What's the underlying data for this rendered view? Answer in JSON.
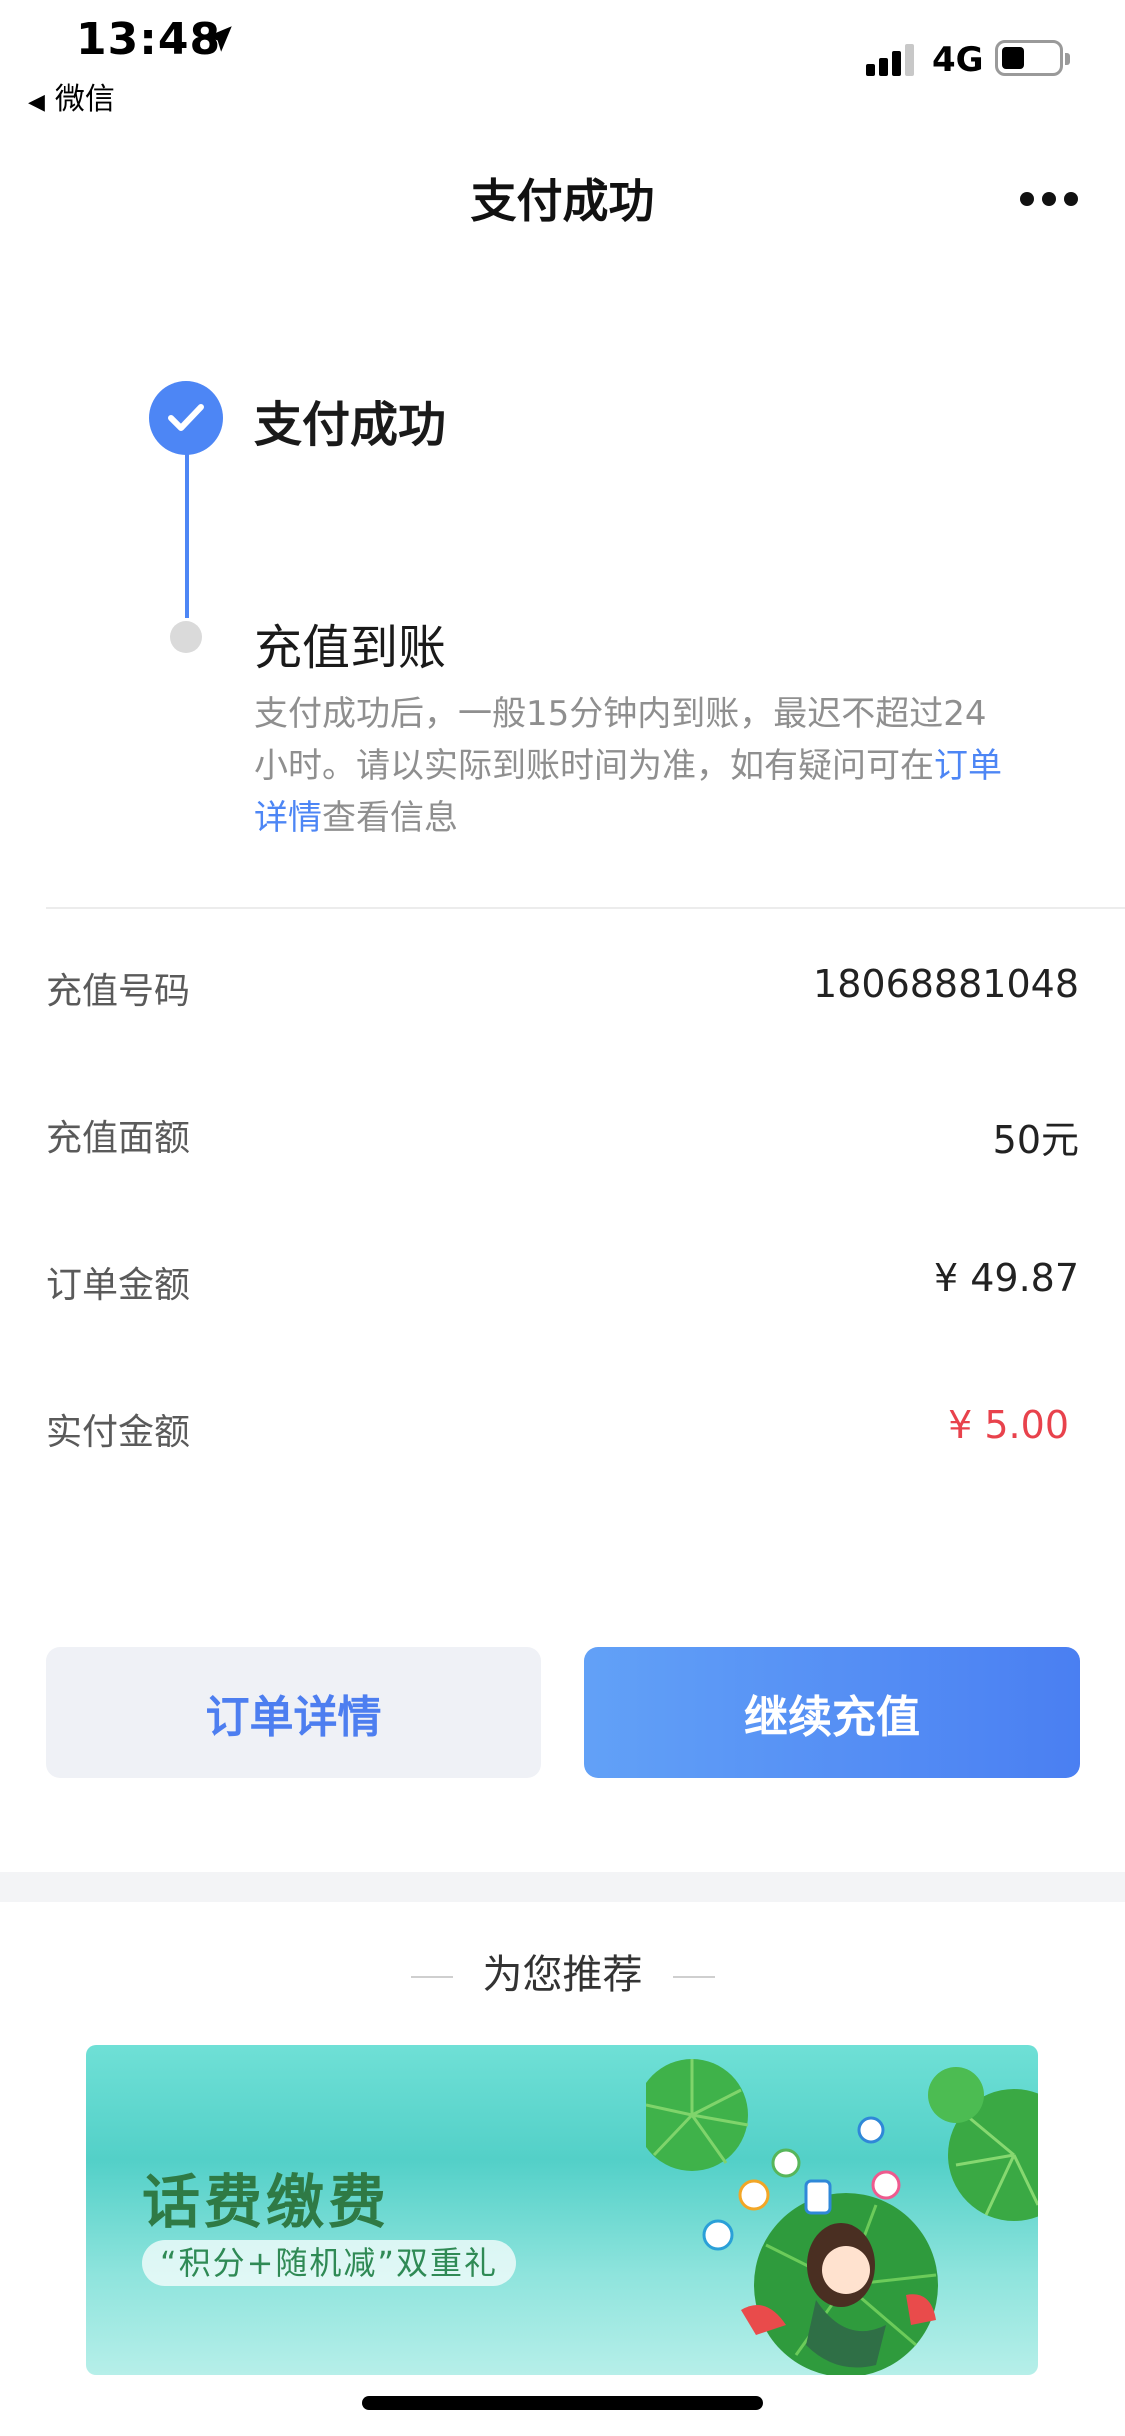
{
  "status_bar": {
    "time": "13:48",
    "back_app": "微信",
    "network": "4G"
  },
  "nav": {
    "title": "支付成功"
  },
  "steps": [
    {
      "title": "支付成功",
      "state": "done"
    },
    {
      "title": "充值到账",
      "state": "pending",
      "desc_before": "支付成功后，一般15分钟内到账，最迟不超过24小时。请以实际到账时间为准，如有疑问可在",
      "desc_link": "订单详情",
      "desc_after": "查看信息"
    }
  ],
  "info": [
    {
      "label": "充值号码",
      "value": "18068881048"
    },
    {
      "label": "充值面额",
      "value": "50元"
    },
    {
      "label": "订单金额",
      "value": "¥ 49.87"
    },
    {
      "label": "实付金额",
      "value": "¥ 5.00"
    }
  ],
  "buttons": {
    "detail": "订单详情",
    "continue": "继续充值"
  },
  "recommend": {
    "heading": "为您推荐"
  },
  "banner": {
    "title": "话费缴费",
    "subtitle": "“积分+随机减”双重礼"
  },
  "colors": {
    "accent": "#4d86f5",
    "price_red": "#e8424c",
    "banner_title": "#2f7a45"
  }
}
